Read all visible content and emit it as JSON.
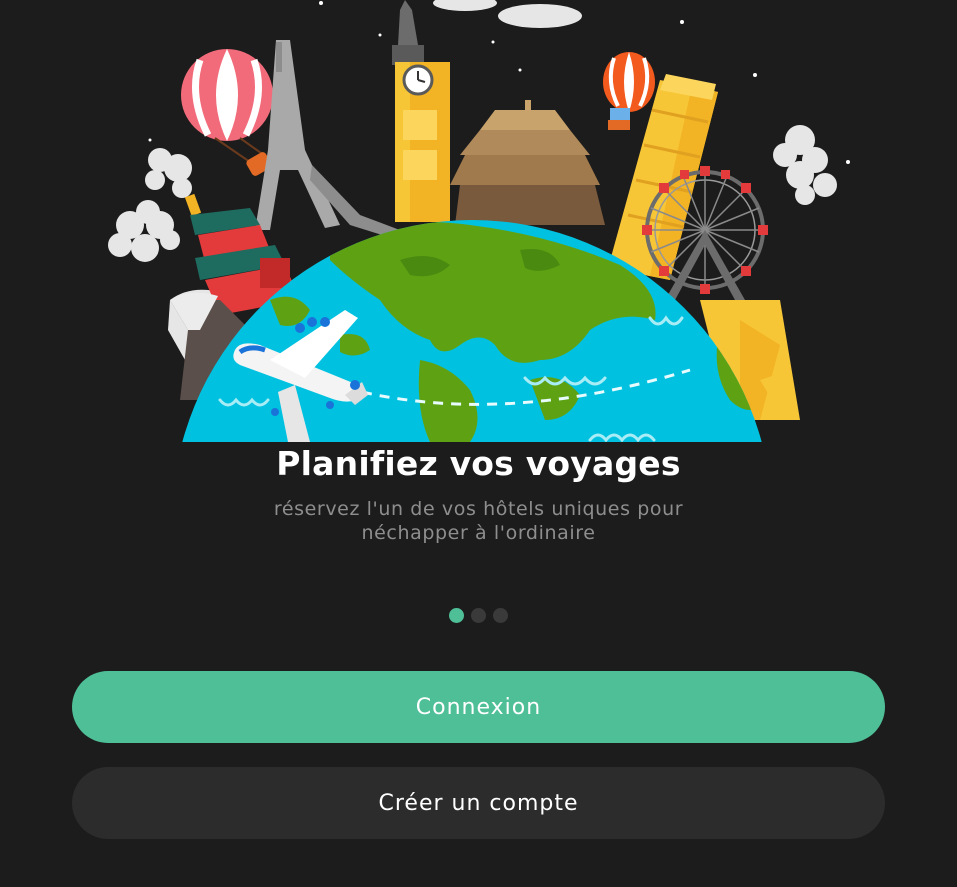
{
  "onboarding": {
    "illustration": "travel-globe-landmarks-illustration",
    "title": "Planifiez vos voyages",
    "subtitle": "réservez l'un de vos hôtels uniques pour néchapper à l'ordinaire",
    "pagination": {
      "total": 3,
      "current": 1
    }
  },
  "actions": {
    "login_label": "Connexion",
    "signup_label": "Créer un compte"
  },
  "colors": {
    "background": "#1c1c1c",
    "accent": "#4fbf98",
    "secondary_button": "#2c2c2c",
    "subtitle_text": "#8e8e8e"
  }
}
